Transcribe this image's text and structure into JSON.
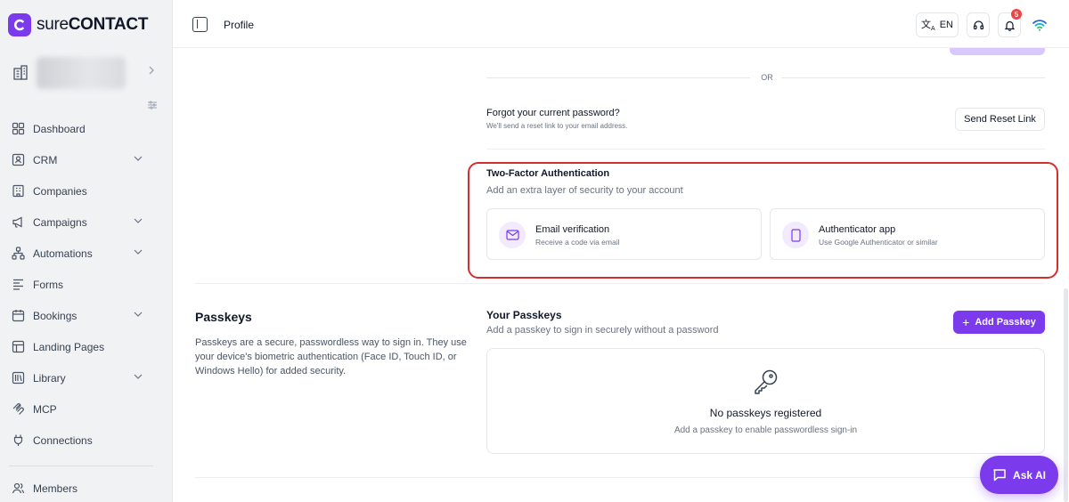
{
  "app": {
    "logo_prefix": "sure",
    "logo_suffix": "CONTACT"
  },
  "sidebar": {
    "items": [
      {
        "label": "Dashboard",
        "icon": "dashboard-icon",
        "chevron": false
      },
      {
        "label": "CRM",
        "icon": "contact-card-icon",
        "chevron": true
      },
      {
        "label": "Companies",
        "icon": "building-icon",
        "chevron": false
      },
      {
        "label": "Campaigns",
        "icon": "megaphone-icon",
        "chevron": true
      },
      {
        "label": "Automations",
        "icon": "workflow-icon",
        "chevron": true
      },
      {
        "label": "Forms",
        "icon": "form-lines-icon",
        "chevron": false
      },
      {
        "label": "Bookings",
        "icon": "calendar-icon",
        "chevron": true
      },
      {
        "label": "Landing Pages",
        "icon": "layout-icon",
        "chevron": false
      },
      {
        "label": "Library",
        "icon": "library-icon",
        "chevron": true
      },
      {
        "label": "MCP",
        "icon": "mcp-icon",
        "chevron": false
      },
      {
        "label": "Connections",
        "icon": "plug-icon",
        "chevron": false
      }
    ],
    "members_label": "Members"
  },
  "topbar": {
    "title": "Profile",
    "lang": "EN",
    "notification_count": "5"
  },
  "password": {
    "or_text": "OR",
    "forgot_title": "Forgot your current password?",
    "forgot_sub": "We'll send a reset link to your email address.",
    "reset_button": "Send Reset Link"
  },
  "two_factor": {
    "title": "Two-Factor Authentication",
    "subtitle": "Add an extra layer of security to your account",
    "methods": [
      {
        "title": "Email verification",
        "sub": "Receive a code via email",
        "icon": "mail-icon"
      },
      {
        "title": "Authenticator app",
        "sub": "Use Google Authenticator or similar",
        "icon": "phone-icon"
      }
    ]
  },
  "passkeys": {
    "heading": "Passkeys",
    "description": "Passkeys are a secure, passwordless way to sign in. They use your device's biometric authentication (Face ID, Touch ID, or Windows Hello) for added security.",
    "your_title": "Your Passkeys",
    "your_sub": "Add a passkey to sign in securely without a password",
    "add_button": "Add Passkey",
    "empty_title": "No passkeys registered",
    "empty_sub": "Add a passkey to enable passwordless sign-in"
  },
  "ask_ai": {
    "label": "Ask AI"
  },
  "colors": {
    "accent": "#7c3aed",
    "highlight": "#d42e2e",
    "badge": "#ef4444"
  }
}
